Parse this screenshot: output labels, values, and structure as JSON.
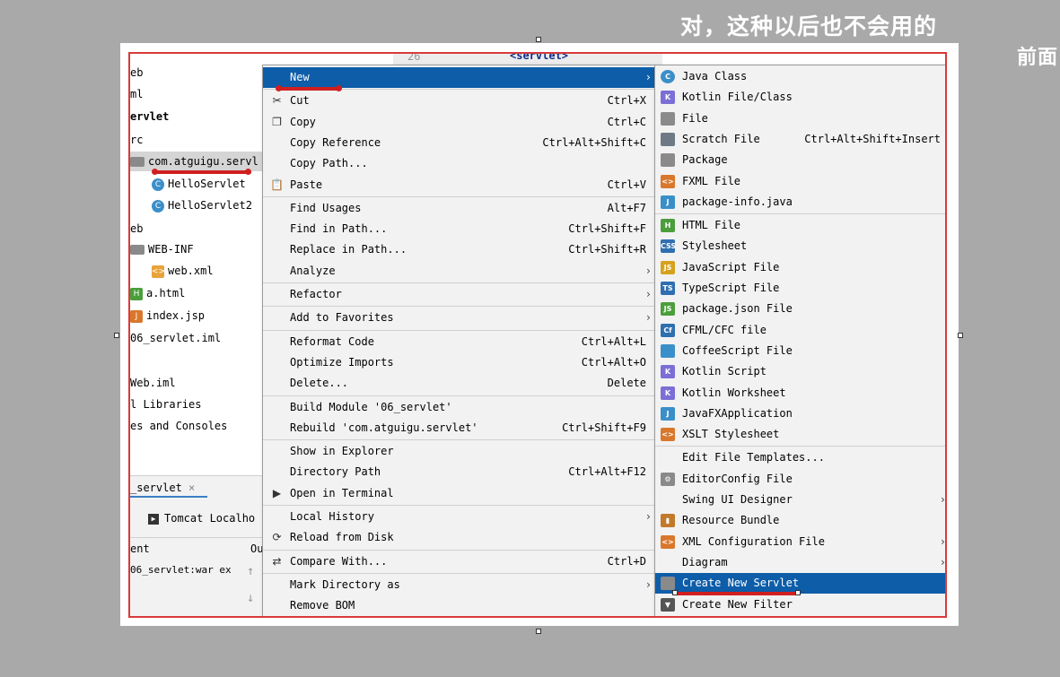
{
  "overlay_text": {
    "line1": "对，这种以后也不会用的",
    "line2": "前面"
  },
  "editor": {
    "line_number": "26",
    "tag": "<servlet>"
  },
  "project_tree": [
    {
      "label": "eb",
      "icon": ""
    },
    {
      "label": "ml",
      "icon": ""
    },
    {
      "label": "ervlet",
      "icon": ""
    },
    {
      "label": "rc",
      "icon": ""
    },
    {
      "label": "com.atguigu.servl",
      "icon": "folder-icon"
    },
    {
      "label": "HelloServlet",
      "icon": "java-class-icon"
    },
    {
      "label": "HelloServlet2",
      "icon": "java-class-icon"
    },
    {
      "label": "eb",
      "icon": ""
    },
    {
      "label": "WEB-INF",
      "icon": "folder-icon"
    },
    {
      "label": "web.xml",
      "icon": "xml-file-icon"
    },
    {
      "label": "a.html",
      "icon": "html-file-icon"
    },
    {
      "label": "index.jsp",
      "icon": "jsp-file-icon"
    },
    {
      "label": "06_servlet.iml",
      "icon": ""
    },
    {
      "label": "Web.iml",
      "icon": ""
    },
    {
      "label": "l Libraries",
      "icon": ""
    },
    {
      "label": "es and Consoles",
      "icon": ""
    }
  ],
  "bottom_panel": {
    "tab": "_servlet",
    "tomcat": "Tomcat Localho",
    "col1": "ent",
    "col2": "Ou",
    "row": "06_servlet:war ex"
  },
  "context_menu": [
    {
      "label": "New",
      "shortcut": "",
      "submenu": true,
      "highlight": true,
      "icon": ""
    },
    {
      "label": "Cut",
      "shortcut": "Ctrl+X",
      "icon": "cut-icon",
      "sep_before": true
    },
    {
      "label": "Copy",
      "shortcut": "Ctrl+C",
      "icon": "copy-icon"
    },
    {
      "label": "Copy Reference",
      "shortcut": "Ctrl+Alt+Shift+C",
      "icon": ""
    },
    {
      "label": "Copy Path...",
      "shortcut": "",
      "icon": ""
    },
    {
      "label": "Paste",
      "shortcut": "Ctrl+V",
      "icon": "paste-icon"
    },
    {
      "label": "Find Usages",
      "shortcut": "Alt+F7",
      "icon": "",
      "sep_before": true
    },
    {
      "label": "Find in Path...",
      "shortcut": "Ctrl+Shift+F",
      "icon": ""
    },
    {
      "label": "Replace in Path...",
      "shortcut": "Ctrl+Shift+R",
      "icon": ""
    },
    {
      "label": "Analyze",
      "shortcut": "",
      "submenu": true,
      "icon": ""
    },
    {
      "label": "Refactor",
      "shortcut": "",
      "submenu": true,
      "icon": "",
      "sep_before": true
    },
    {
      "label": "Add to Favorites",
      "shortcut": "",
      "submenu": true,
      "icon": "",
      "sep_before": true
    },
    {
      "label": "Reformat Code",
      "shortcut": "Ctrl+Alt+L",
      "icon": "",
      "sep_before": true
    },
    {
      "label": "Optimize Imports",
      "shortcut": "Ctrl+Alt+O",
      "icon": ""
    },
    {
      "label": "Delete...",
      "shortcut": "Delete",
      "icon": ""
    },
    {
      "label": "Build Module '06_servlet'",
      "shortcut": "",
      "icon": "",
      "sep_before": true
    },
    {
      "label": "Rebuild 'com.atguigu.servlet'",
      "shortcut": "Ctrl+Shift+F9",
      "icon": ""
    },
    {
      "label": "Show in Explorer",
      "shortcut": "",
      "icon": "",
      "sep_before": true
    },
    {
      "label": "Directory Path",
      "shortcut": "Ctrl+Alt+F12",
      "icon": ""
    },
    {
      "label": "Open in Terminal",
      "shortcut": "",
      "icon": "terminal-icon"
    },
    {
      "label": "Local History",
      "shortcut": "",
      "submenu": true,
      "icon": "",
      "sep_before": true
    },
    {
      "label": "Reload from Disk",
      "shortcut": "",
      "icon": "reload-icon"
    },
    {
      "label": "Compare With...",
      "shortcut": "Ctrl+D",
      "icon": "compare-icon",
      "sep_before": true
    },
    {
      "label": "Mark Directory as",
      "shortcut": "",
      "submenu": true,
      "icon": "",
      "sep_before": true
    },
    {
      "label": "Remove BOM",
      "shortcut": "",
      "icon": ""
    }
  ],
  "new_submenu": [
    {
      "label": "Java Class",
      "shortcut": "",
      "icon": "java-class-icon",
      "badge": "C",
      "color": "#3b8fc9"
    },
    {
      "label": "Kotlin File/Class",
      "shortcut": "",
      "icon": "kotlin-file-icon",
      "badge": "K",
      "color": "#7b6fd6"
    },
    {
      "label": "File",
      "shortcut": "",
      "icon": "file-icon",
      "badge": "",
      "color": "#8a8a8a"
    },
    {
      "label": "Scratch File",
      "shortcut": "Ctrl+Alt+Shift+Insert",
      "icon": "scratch-file-icon",
      "badge": "",
      "color": "#6d7a86"
    },
    {
      "label": "Package",
      "shortcut": "",
      "icon": "package-icon",
      "badge": "",
      "color": "#8a8a8a"
    },
    {
      "label": "FXML File",
      "shortcut": "",
      "icon": "fxml-file-icon",
      "badge": "<>",
      "color": "#d9772c"
    },
    {
      "label": "package-info.java",
      "shortcut": "",
      "icon": "package-info-icon",
      "badge": "J",
      "color": "#3b8fc9"
    },
    {
      "label": "HTML File",
      "shortcut": "",
      "icon": "html-file-icon",
      "badge": "H",
      "color": "#4b9e3c",
      "sep_before": true
    },
    {
      "label": "Stylesheet",
      "shortcut": "",
      "icon": "css-file-icon",
      "badge": "CSS",
      "color": "#2f6fb0"
    },
    {
      "label": "JavaScript File",
      "shortcut": "",
      "icon": "javascript-file-icon",
      "badge": "JS",
      "color": "#d6a21e"
    },
    {
      "label": "TypeScript File",
      "shortcut": "",
      "icon": "typescript-file-icon",
      "badge": "TS",
      "color": "#2f6fb0"
    },
    {
      "label": "package.json File",
      "shortcut": "",
      "icon": "package-json-icon",
      "badge": "JS",
      "color": "#4b9e3c"
    },
    {
      "label": "CFML/CFC file",
      "shortcut": "",
      "icon": "cfml-file-icon",
      "badge": "Cf",
      "color": "#2f6fb0"
    },
    {
      "label": "CoffeeScript File",
      "shortcut": "",
      "icon": "coffeescript-file-icon",
      "badge": "",
      "color": "#3b8fc9"
    },
    {
      "label": "Kotlin Script",
      "shortcut": "",
      "icon": "kotlin-script-icon",
      "badge": "K",
      "color": "#7b6fd6"
    },
    {
      "label": "Kotlin Worksheet",
      "shortcut": "",
      "icon": "kotlin-worksheet-icon",
      "badge": "K",
      "color": "#7b6fd6"
    },
    {
      "label": "JavaFXApplication",
      "shortcut": "",
      "icon": "javafx-icon",
      "badge": "J",
      "color": "#3b8fc9"
    },
    {
      "label": "XSLT Stylesheet",
      "shortcut": "",
      "icon": "xslt-file-icon",
      "badge": "<>",
      "color": "#d9772c"
    },
    {
      "label": "Edit File Templates...",
      "shortcut": "",
      "icon": "",
      "badge": "",
      "color": "",
      "sep_before": true
    },
    {
      "label": "EditorConfig File",
      "shortcut": "",
      "icon": "gear-icon",
      "badge": "⚙",
      "color": "#8a8a8a"
    },
    {
      "label": "Swing UI Designer",
      "shortcut": "",
      "submenu": true,
      "icon": "",
      "badge": "",
      "color": ""
    },
    {
      "label": "Resource Bundle",
      "shortcut": "",
      "icon": "resource-bundle-icon",
      "badge": "▮",
      "color": "#c27a2a"
    },
    {
      "label": "XML Configuration File",
      "shortcut": "",
      "submenu": true,
      "icon": "xml-file-icon",
      "badge": "<>",
      "color": "#d9772c"
    },
    {
      "label": "Diagram",
      "shortcut": "",
      "submenu": true,
      "icon": "",
      "badge": "",
      "color": ""
    },
    {
      "label": "Create New Servlet",
      "shortcut": "",
      "icon": "servlet-icon",
      "badge": "",
      "color": "#8a8a8a",
      "highlight": true
    },
    {
      "label": "Create New Filter",
      "shortcut": "",
      "icon": "filter-icon",
      "badge": "▼",
      "color": "#555555"
    }
  ],
  "colors": {
    "highlight": "#0d5da8",
    "annotation_red": "#d01f1f"
  }
}
